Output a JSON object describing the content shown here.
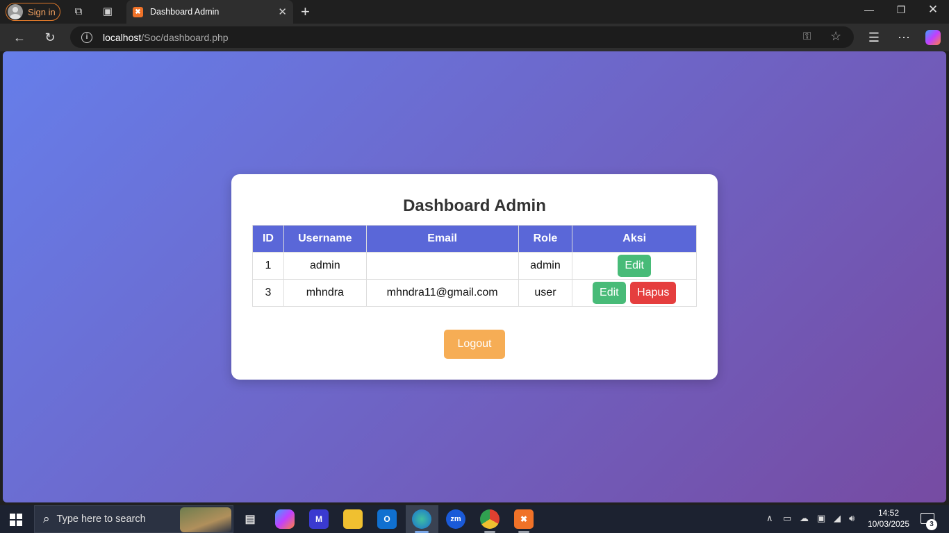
{
  "browser": {
    "signin_label": "Sign in",
    "tab_title": "Dashboard Admin",
    "url_host": "localhost",
    "url_path": "/Soc/dashboard.php"
  },
  "page": {
    "heading": "Dashboard Admin",
    "table": {
      "headers": [
        "ID",
        "Username",
        "Email",
        "Role",
        "Aksi"
      ],
      "rows": [
        {
          "id": "1",
          "username": "admin",
          "email": "",
          "role": "admin",
          "actions": [
            "Edit"
          ]
        },
        {
          "id": "3",
          "username": "mhndra",
          "email": "mhndra11@gmail.com",
          "role": "user",
          "actions": [
            "Edit",
            "Hapus"
          ]
        }
      ]
    },
    "logout_label": "Logout"
  },
  "taskbar": {
    "search_placeholder": "Type here to search",
    "time": "14:52",
    "date": "10/03/2025",
    "notification_count": "3"
  },
  "colors": {
    "gradient_start": "#667eea",
    "gradient_end": "#764ba2",
    "table_header": "#5a67d8",
    "edit_button": "#48bb78",
    "delete_button": "#e53e3e",
    "logout_button": "#f6ad55"
  }
}
